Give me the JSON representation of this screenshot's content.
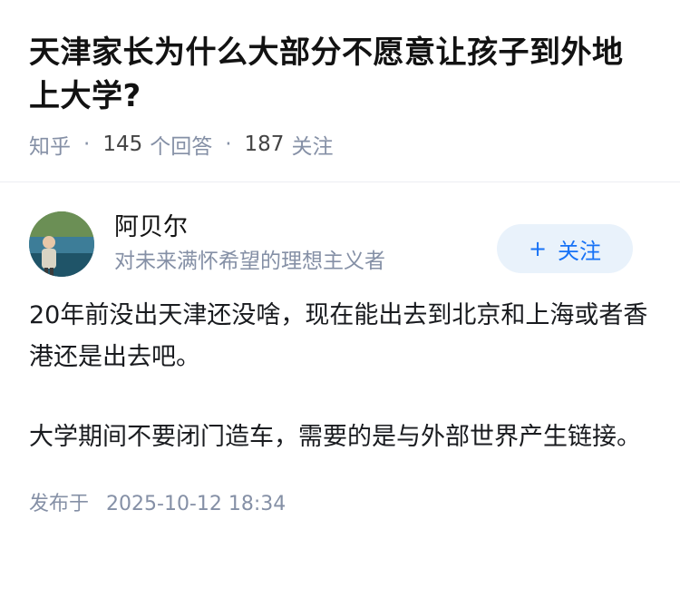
{
  "question": {
    "title": "天津家长为什么大部分不愿意让孩子到外地上大学?",
    "source": "知乎",
    "answer_count": "145",
    "answer_label": "个回答",
    "follow_count": "187",
    "follow_label": "关注",
    "separator": "·"
  },
  "author": {
    "name": "阿贝尔",
    "bio": "对未来满怀希望的理想主义者",
    "follow_button": "关注",
    "follow_icon": "+"
  },
  "answer": {
    "paragraphs": [
      "20年前没出天津还没啥，现在能出去到北京和上海或者香港还是出去吧。",
      "大学期间不要闭门造车，需要的是与外部世界产生链接。"
    ],
    "published_label": "发布于",
    "published_time": "2025-10-12 18:34"
  },
  "colors": {
    "accent": "#1772f6",
    "muted": "#8590a6",
    "follow_bg": "#e9f2fb"
  }
}
